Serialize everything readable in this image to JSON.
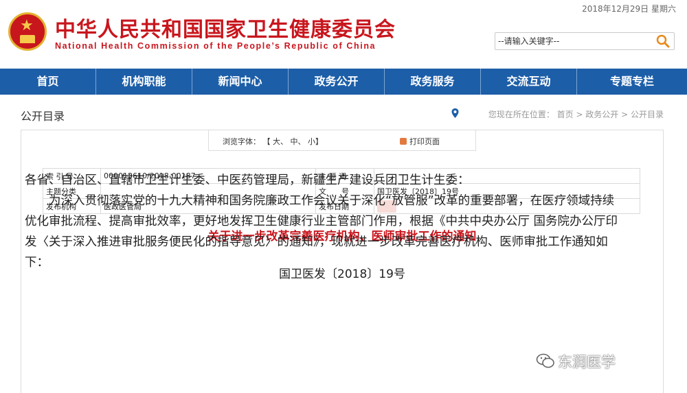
{
  "header": {
    "date": "2018年12月29日 星期六",
    "title_cn": "中华人民共和国国家卫生健康委员会",
    "title_en": "National Health Commission of the People’s Republic of China",
    "search_placeholder": "--请输入关键字--"
  },
  "nav": {
    "items": [
      "首页",
      "机构职能",
      "新闻中心",
      "政务公开",
      "政务服务",
      "交流互动",
      "专题专栏"
    ]
  },
  "breadcrumb": {
    "title": "公开目录",
    "trail": "您现在所在位置：  首页  >  政务公开  >  公开目录"
  },
  "toolbar": {
    "font_label": "浏览字体：",
    "font_options": "【 大、 中、 小】",
    "print_label": "打印页面"
  },
  "meta": {
    "index_label": "索 引 号",
    "index_value": "000013610/2018-00187",
    "subject_label": "主题分类",
    "subject_value": "",
    "issuer_label": "发布机构",
    "issuer_value": "医政医管局",
    "keywords_label": "主 题 词",
    "keywords_value": "",
    "docno_label": "文　　号",
    "docno_value": "国卫医发〔2018〕19号",
    "date_label": "发布日期",
    "date_value": ""
  },
  "document": {
    "title": "关于进一步改革完善医疗机构、医师审批工作的通知",
    "number": "国卫医发〔2018〕19号",
    "recipients": "各省、自治区、直辖市卫生计生委、中医药管理局，新疆生产建设兵团卫生计生委：",
    "paragraph": "为深入贯彻落实党的十九大精神和国务院廉政工作会议关于深化“放管服”改革的重要部署，在医疗领域持续优化审批流程、提高审批效率，更好地发挥卫生健康行业主管部门作用，根据《中共中央办公厅 国务院办公厅印发〈关于深入推进审批服务便民化的指导意见〉的通知》，现就进一步改革完善医疗机构、医师审批工作通知如下："
  },
  "watermark": {
    "text": "东润医学"
  },
  "colors": {
    "brand_red": "#c8161d",
    "nav_blue": "#1d5ea8"
  }
}
